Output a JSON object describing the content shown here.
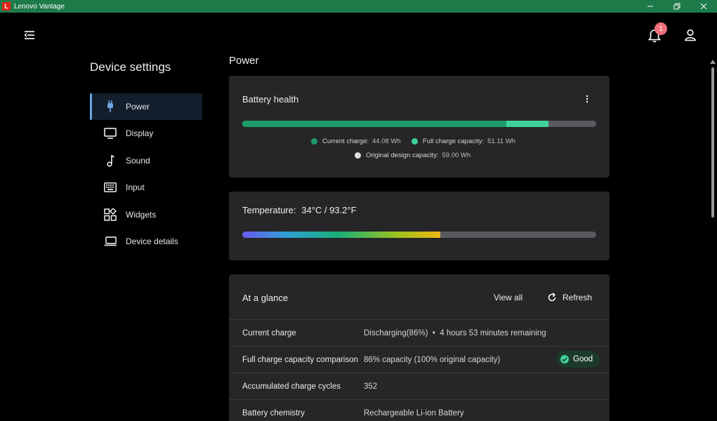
{
  "window": {
    "logo_letter": "L",
    "title": "Lenovo Vantage"
  },
  "header": {
    "notification_count": "1"
  },
  "sidebar": {
    "title": "Device settings",
    "items": [
      {
        "label": "Power",
        "icon": "plug-icon",
        "active": true
      },
      {
        "label": "Display",
        "icon": "monitor-icon",
        "active": false
      },
      {
        "label": "Sound",
        "icon": "music-note-icon",
        "active": false
      },
      {
        "label": "Input",
        "icon": "keyboard-icon",
        "active": false
      },
      {
        "label": "Widgets",
        "icon": "widgets-icon",
        "active": false
      },
      {
        "label": "Device details",
        "icon": "laptop-icon",
        "active": false
      }
    ]
  },
  "main": {
    "title": "Power",
    "battery_health": {
      "title": "Battery health",
      "current_charge_label": "Current charge:",
      "current_charge_value": "44.08 Wh",
      "full_capacity_label": "Full charge capacity:",
      "full_capacity_value": "51.11 Wh",
      "design_capacity_label": "Original design capacity:",
      "design_capacity_value": "59.00 Wh",
      "current_charge_fraction": 0.747,
      "full_capacity_fraction": 0.866,
      "colors": {
        "current": "#1e9c6a",
        "full": "#3fd39a",
        "design": "#5a5a5e"
      }
    },
    "temperature": {
      "label": "Temperature:",
      "value": "34°C / 93.2°F",
      "fill_fraction": 0.56
    },
    "glance": {
      "title": "At a glance",
      "view_all": "View all",
      "refresh": "Refresh",
      "rows": [
        {
          "label": "Current charge",
          "value": "Discharging(86%)  •  4 hours 53 minutes remaining"
        },
        {
          "label": "Full charge capacity comparison",
          "value": "86% capacity (100% original capacity)",
          "badge": "Good"
        },
        {
          "label": "Accumulated charge cycles",
          "value": "352"
        },
        {
          "label": "Battery chemistry",
          "value": "Rechargeable Li-ion Battery"
        }
      ]
    }
  }
}
